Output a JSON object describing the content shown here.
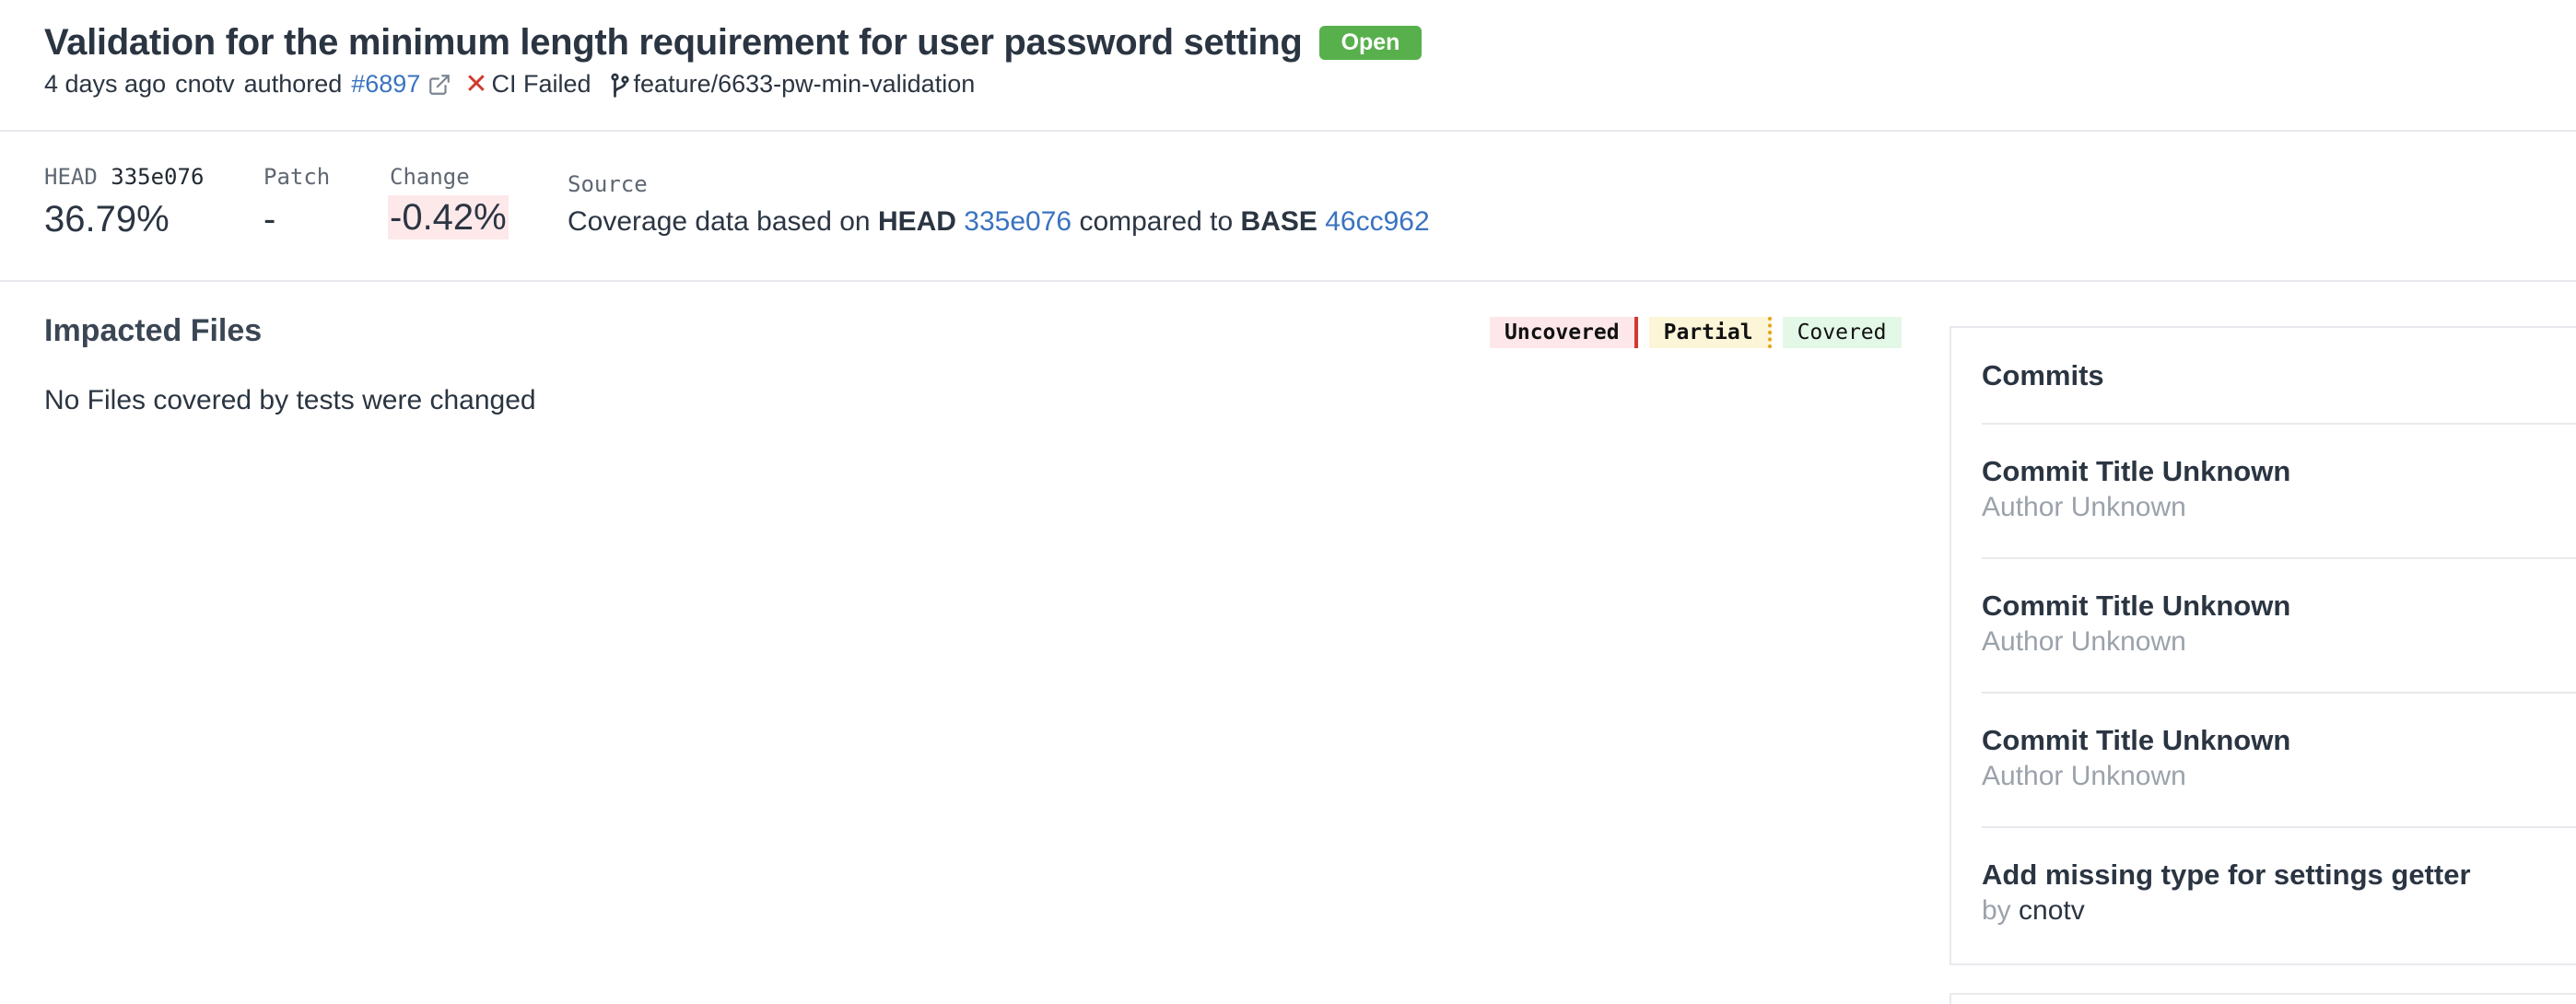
{
  "header": {
    "title": "Validation for the minimum length requirement for user password setting",
    "status": "Open",
    "meta": {
      "time_ago": "4 days ago",
      "author": "cnotv",
      "authored_label": "authored",
      "pr_number": "#6897",
      "ci_status": "CI Failed",
      "branch": "feature/6633-pw-min-validation"
    }
  },
  "coverage": {
    "head": {
      "label": "HEAD",
      "sha": "335e076",
      "value": "36.79%"
    },
    "patch": {
      "label": "Patch",
      "value": "-"
    },
    "change": {
      "label": "Change",
      "value": "-0.42%"
    },
    "source": {
      "label": "Source",
      "text_prefix": "Coverage data based on",
      "head_label": "HEAD",
      "head_sha": "335e076",
      "compared_text": "compared to",
      "base_label": "BASE",
      "base_sha": "46cc962"
    }
  },
  "impacted": {
    "title": "Impacted Files",
    "empty_message": "No Files covered by tests were changed",
    "legend": {
      "uncovered": "Uncovered",
      "partial": "Partial",
      "covered": "Covered"
    }
  },
  "commits": {
    "heading": "Commits",
    "items": [
      {
        "title": "Commit Title Unknown",
        "author": "Author Unknown"
      },
      {
        "title": "Commit Title Unknown",
        "author": "Author Unknown"
      },
      {
        "title": "Commit Title Unknown",
        "author": "Author Unknown"
      },
      {
        "title": "Add missing type for settings getter",
        "by_label": "by",
        "author": "cnotv"
      }
    ]
  },
  "colors": {
    "badge_open": "#58b04c",
    "link": "#3a73c0",
    "ci_failed": "#d0392f",
    "uncovered_bg": "#fde7ea",
    "partial_bg": "#fdf5d8",
    "covered_bg": "#e3f8e6"
  },
  "icons": {
    "external_link": "external-link-icon",
    "ci_status": "close-icon",
    "branch": "git-branch-icon"
  }
}
